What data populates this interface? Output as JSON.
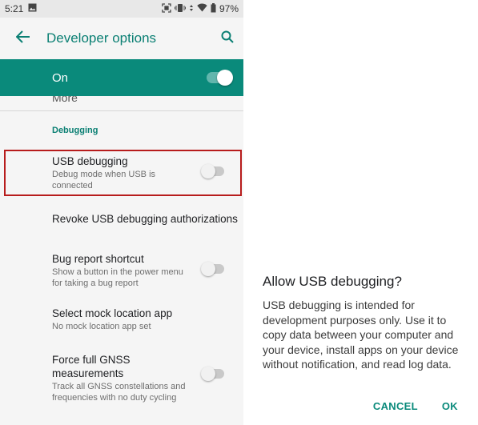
{
  "statusbar": {
    "time": "5:21",
    "battery": "97%",
    "icons": [
      "image-icon",
      "scan-icon",
      "vibrate-icon",
      "data-icon",
      "wifi-icon",
      "battery-icon"
    ]
  },
  "appbar": {
    "title": "Developer options",
    "back_icon": "back-arrow-icon",
    "search_icon": "search-icon"
  },
  "master_switch": {
    "label": "On",
    "state": true
  },
  "partial_item": {
    "label": "More"
  },
  "section": {
    "header": "Debugging"
  },
  "items": [
    {
      "title": "USB debugging",
      "subtitle": "Debug mode when USB is connected",
      "toggle": false
    },
    {
      "title": "Revoke USB debugging authorizations",
      "subtitle": ""
    },
    {
      "title": "Bug report shortcut",
      "subtitle": "Show a button in the power menu for taking a bug report",
      "toggle": false
    },
    {
      "title": "Select mock location app",
      "subtitle": "No mock location app set"
    },
    {
      "title": "Force full GNSS measurements",
      "subtitle": "Track all GNSS constellations and frequencies with no duty cycling",
      "toggle": false
    }
  ],
  "dialog": {
    "title": "Allow USB debugging?",
    "body": "USB debugging is intended for development purposes only. Use it to copy data between your computer and your device, install apps on your device without notification, and read log data.",
    "cancel": "CANCEL",
    "ok": "OK"
  },
  "colors": {
    "accent": "#0a8a7b",
    "title_teal": "#0a7f73",
    "highlight": "#b71c1c"
  }
}
